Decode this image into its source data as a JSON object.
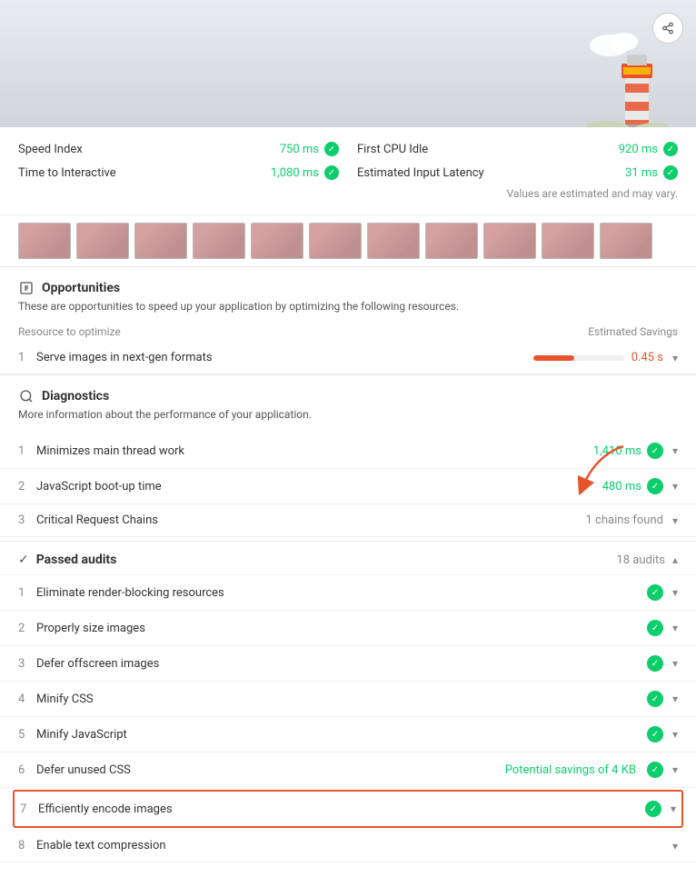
{
  "header": {
    "share_label": "share"
  },
  "metrics": {
    "estimated_note": "Values are estimated and may vary.",
    "items": [
      {
        "label": "Speed Index",
        "value": "750 ms",
        "status": "pass"
      },
      {
        "label": "First CPU Idle",
        "value": "920 ms",
        "status": "pass"
      },
      {
        "label": "Time to Interactive",
        "value": "1,080 ms",
        "status": "pass"
      },
      {
        "label": "Estimated Input Latency",
        "value": "31 ms",
        "status": "pass"
      }
    ]
  },
  "opportunities": {
    "section_title": "Opportunities",
    "section_desc": "These are opportunities to speed up your application by optimizing the following resources.",
    "col_resource": "Resource to optimize",
    "col_savings": "Estimated Savings",
    "items": [
      {
        "number": "1",
        "label": "Serve images in next-gen formats",
        "savings_value": "0.45 s",
        "bar_percent": 45
      }
    ]
  },
  "diagnostics": {
    "section_title": "Diagnostics",
    "section_desc": "More information about the performance of your application.",
    "items": [
      {
        "number": "1",
        "label": "Minimizes main thread work",
        "value": "1,410 ms",
        "status": "green"
      },
      {
        "number": "2",
        "label": "JavaScript boot-up time",
        "value": "480 ms",
        "status": "green"
      },
      {
        "number": "3",
        "label": "Critical Request Chains",
        "value": "1 chains found",
        "status": "gray"
      }
    ]
  },
  "passed_audits": {
    "label": "Passed audits",
    "count": "18 audits",
    "items": [
      {
        "number": "1",
        "label": "Eliminate render-blocking resources",
        "has_check": true
      },
      {
        "number": "2",
        "label": "Properly size images",
        "has_check": true
      },
      {
        "number": "3",
        "label": "Defer offscreen images",
        "has_check": true
      },
      {
        "number": "4",
        "label": "Minify CSS",
        "has_check": true
      },
      {
        "number": "5",
        "label": "Minify JavaScript",
        "has_check": true
      },
      {
        "number": "6",
        "label": "Defer unused CSS",
        "has_check": true,
        "savings": "Potential savings of 4 KB"
      },
      {
        "number": "7",
        "label": "Efficiently encode images",
        "has_check": true,
        "highlighted": true
      },
      {
        "number": "8",
        "label": "Enable text compression",
        "has_check": false
      }
    ]
  }
}
